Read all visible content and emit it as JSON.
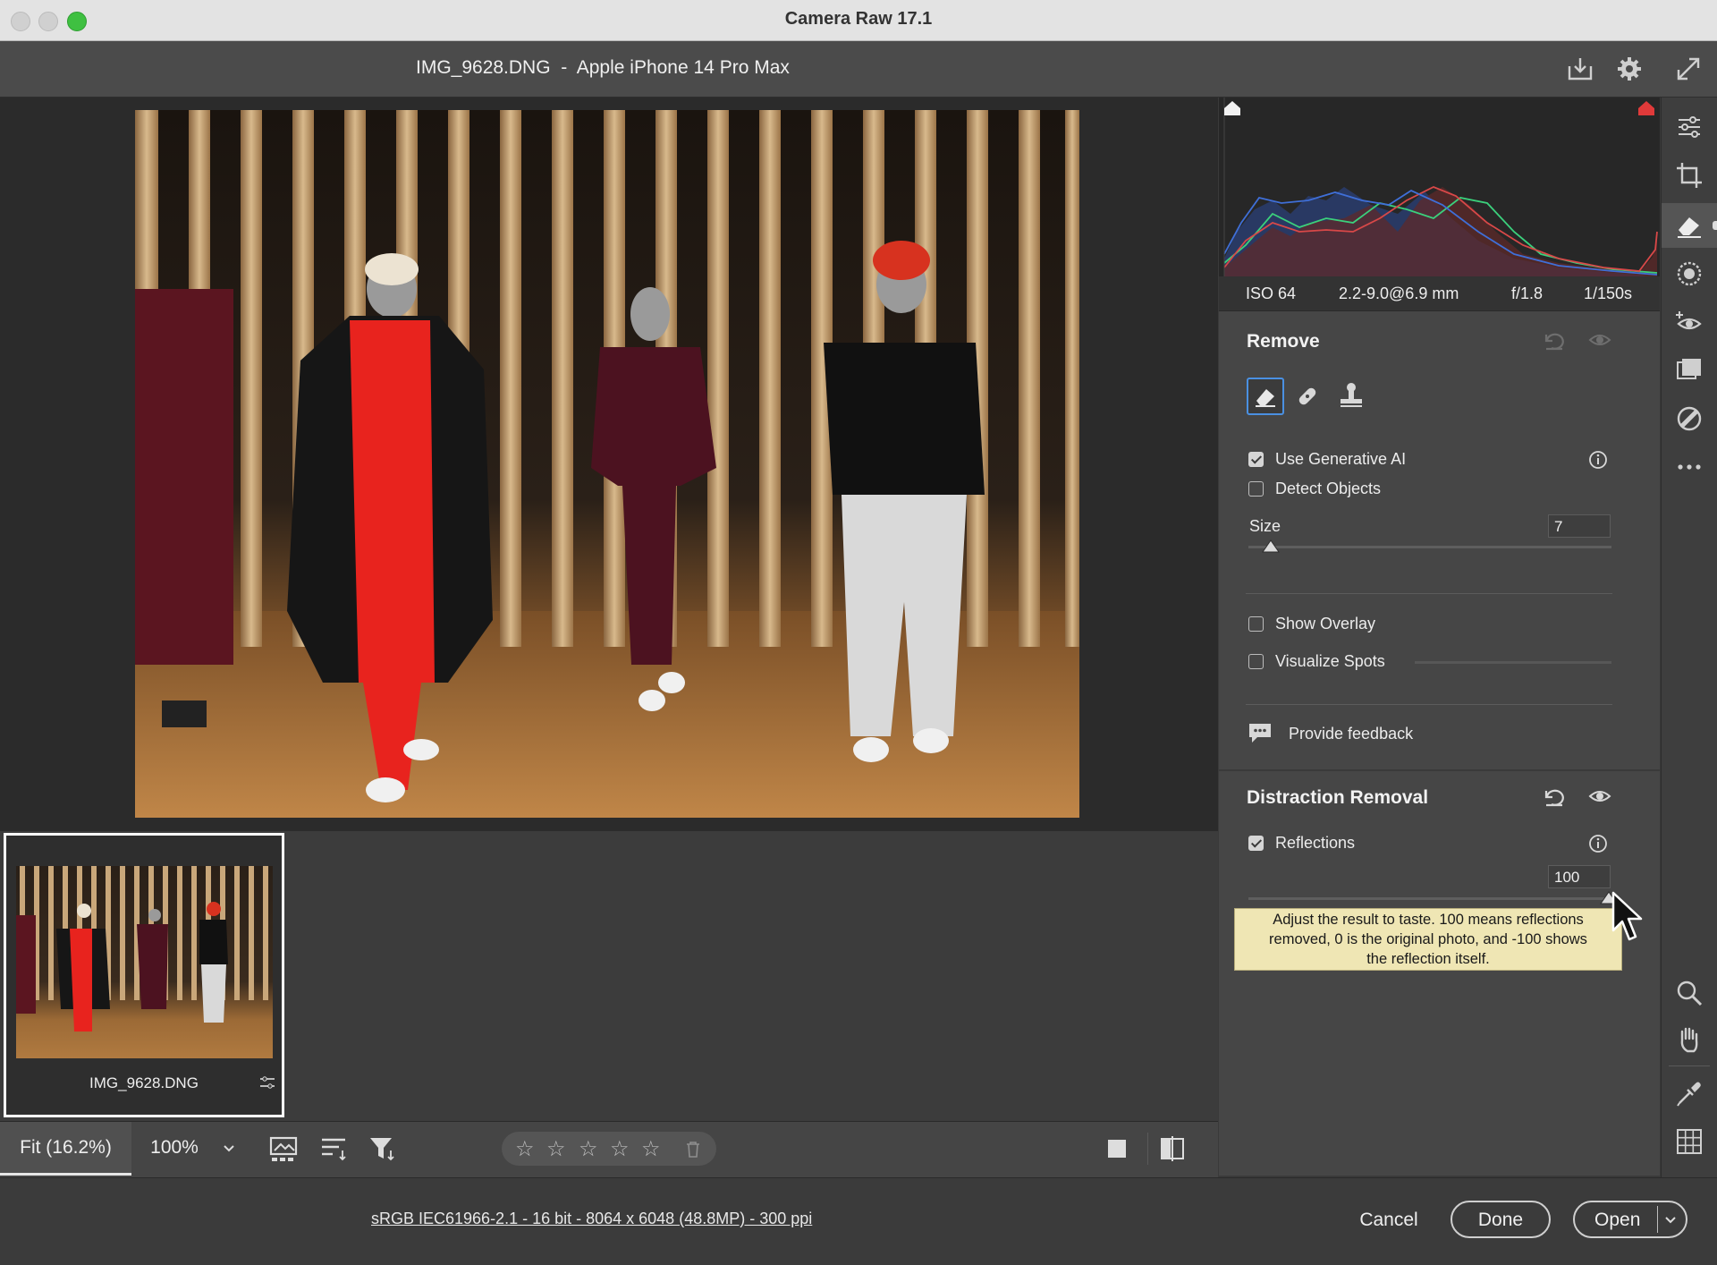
{
  "window": {
    "title": "Camera Raw 17.1"
  },
  "header": {
    "file_title": "IMG_9628.DNG  -  Apple iPhone 14 Pro Max"
  },
  "filmstrip": {
    "thumb_name": "IMG_9628.DNG"
  },
  "bottom_toolbar": {
    "fit_label": "Fit (16.2%)",
    "zoom_label": "100%",
    "rating_stars": 5
  },
  "footer": {
    "file_info": "sRGB IEC61966-2.1 - 16 bit - 8064 x 6048 (48.8MP) - 300 ppi",
    "cancel_label": "Cancel",
    "done_label": "Done",
    "open_label": "Open"
  },
  "exif": {
    "iso": "ISO 64",
    "focal": "2.2-9.0@6.9 mm",
    "aperture": "f/1.8",
    "shutter": "1/150s"
  },
  "remove_panel": {
    "title": "Remove",
    "use_gen_ai_label": "Use Generative AI",
    "use_gen_ai_checked": true,
    "detect_objects_label": "Detect Objects",
    "detect_objects_checked": false,
    "size_label": "Size",
    "size_value": "7",
    "show_overlay_label": "Show Overlay",
    "visualize_spots_label": "Visualize Spots",
    "feedback_label": "Provide feedback"
  },
  "distraction_panel": {
    "title": "Distraction Removal",
    "reflections_label": "Reflections",
    "reflections_checked": true,
    "reflections_value": "100"
  },
  "tooltip": {
    "line1": "Adjust the result to taste. 100 means reflections",
    "line2": "removed, 0 is the original photo, and -100 shows",
    "line3": "the reflection itself."
  },
  "colors": {
    "accent": "#4a90e2",
    "traffic_close": "#ed6a5e",
    "traffic_min": "#f5bf4f",
    "traffic_max": "#61c554"
  }
}
